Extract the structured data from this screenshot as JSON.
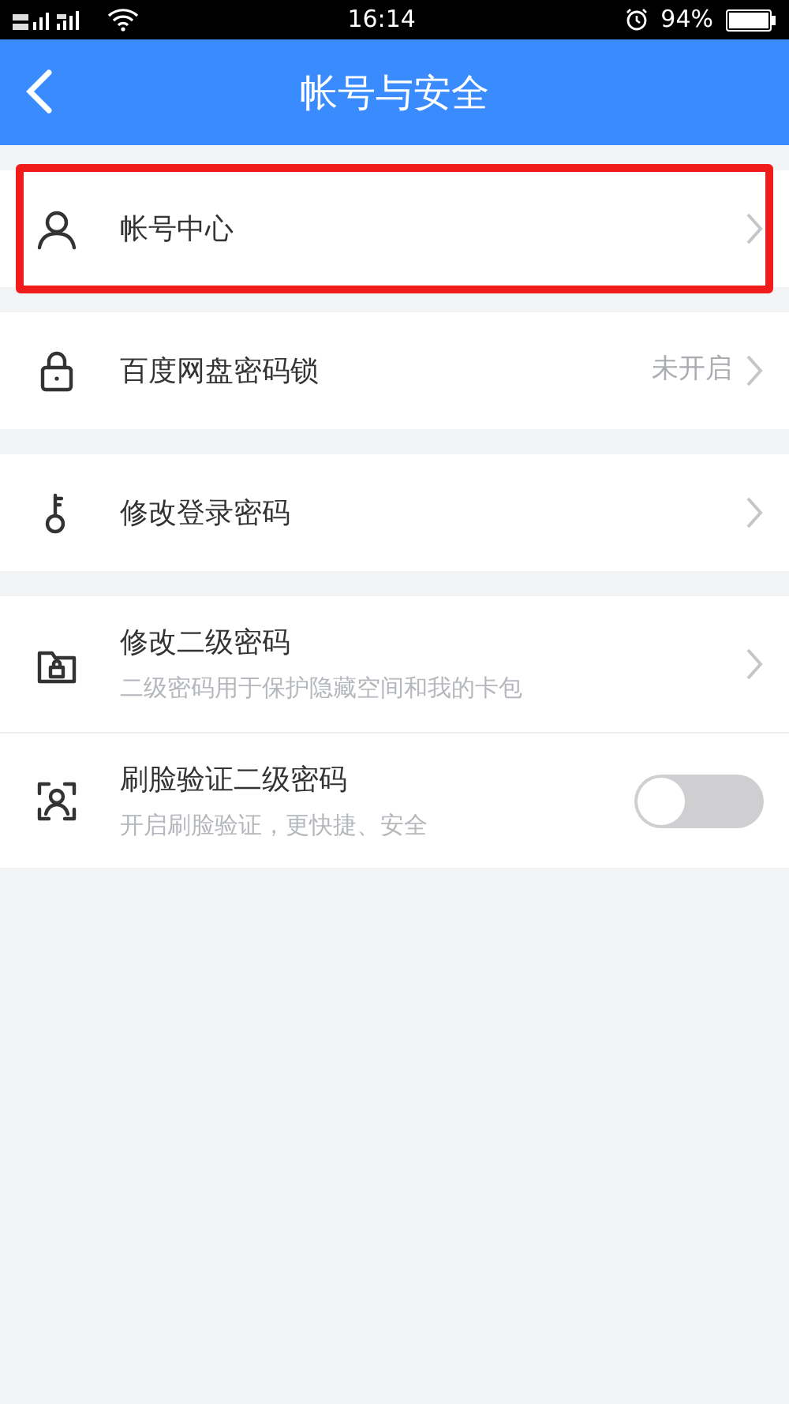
{
  "status_bar": {
    "time": "16:14",
    "battery": "94%"
  },
  "header": {
    "title": "帐号与安全"
  },
  "groups": [
    {
      "items": [
        {
          "kind": "link",
          "title": "帐号中心",
          "highlighted": true
        }
      ]
    },
    {
      "items": [
        {
          "kind": "link",
          "title": "百度网盘密码锁",
          "value": "未开启",
          "highlighted": false
        }
      ]
    },
    {
      "items": [
        {
          "kind": "link",
          "title": "修改登录密码",
          "highlighted": false
        }
      ]
    },
    {
      "items": [
        {
          "kind": "link",
          "title": "修改二级密码",
          "subtitle": "二级密码用于保护隐藏空间和我的卡包",
          "highlighted": false
        },
        {
          "kind": "toggle",
          "title": "刷脸验证二级密码",
          "subtitle": "开启刷脸验证，更快捷、安全",
          "on": false,
          "highlighted": false
        }
      ]
    }
  ]
}
